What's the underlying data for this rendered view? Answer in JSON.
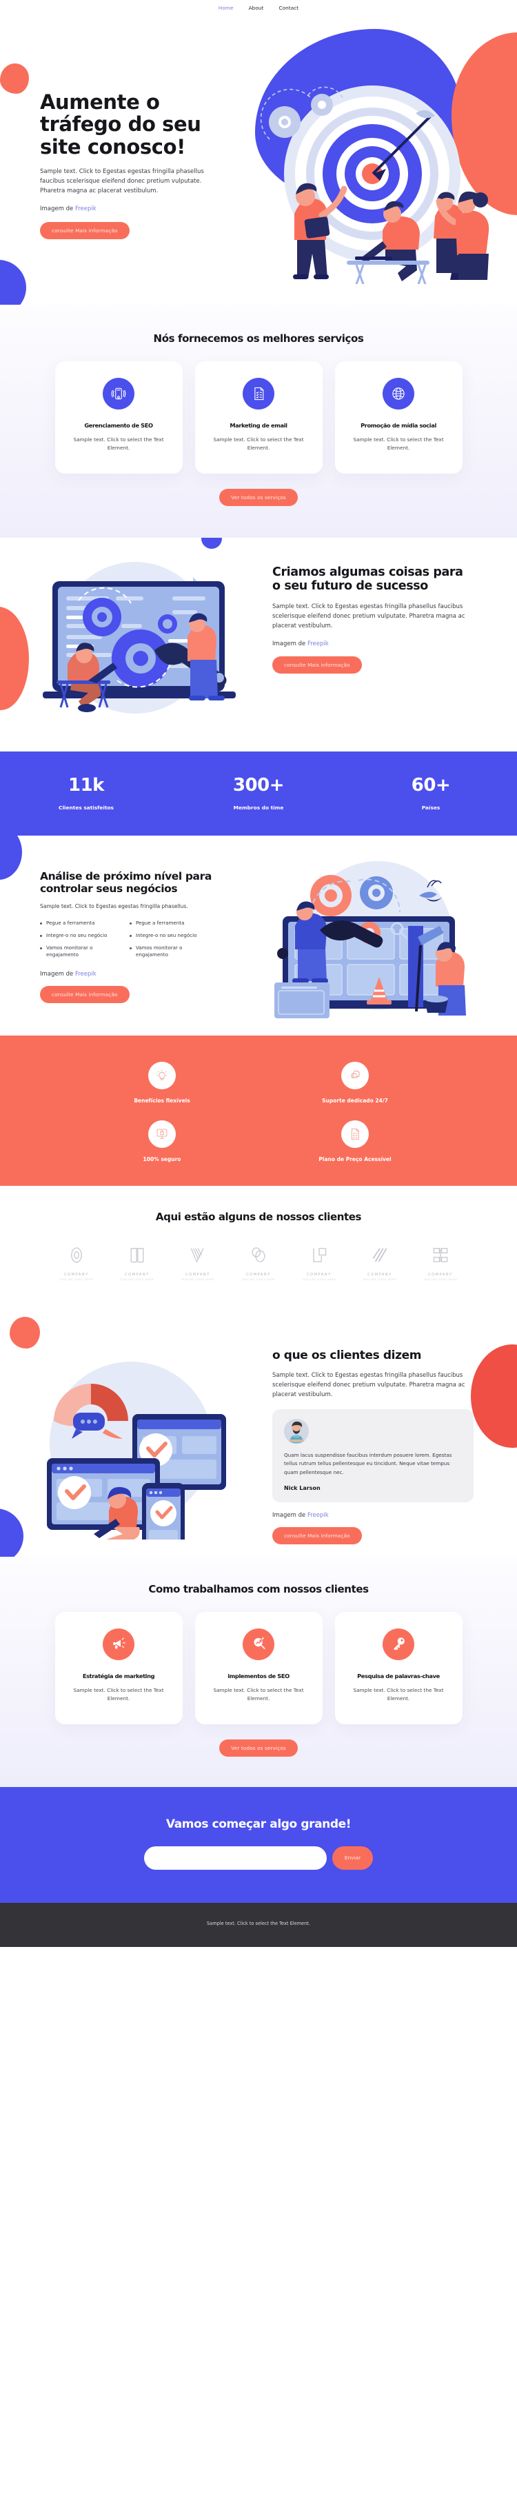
{
  "nav": {
    "items": [
      {
        "label": "Home",
        "active": true
      },
      {
        "label": "About",
        "active": false
      },
      {
        "label": "Contact",
        "active": false
      }
    ]
  },
  "hero": {
    "title": "Aumente o tráfego do seu site conosco!",
    "body": "Sample text. Click to Egestas egestas fringilla phasellus faucibus scelerisque eleifend donec pretium vulputate. Pharetra magna ac placerat vestibulum.",
    "credit_prefix": "Imagem de ",
    "credit_link": "Freepik",
    "cta": "consulte Mais informação",
    "illustration": "target-team-dartboard-illustration"
  },
  "services": {
    "title": "Nós fornecemos os melhores serviços",
    "cards": [
      {
        "icon": "mobile-signal-icon",
        "title": "Gerenciamento de SEO",
        "body": "Sample text. Click to select the Text Element."
      },
      {
        "icon": "checklist-document-icon",
        "title": "Marketing de email",
        "body": "Sample text. Click to select the Text Element."
      },
      {
        "icon": "globe-icon",
        "title": "Promoção de mídia social",
        "body": "Sample text. Click to select the Text Element."
      }
    ],
    "cta": "Ver todos os serviços"
  },
  "future": {
    "title": "Criamos algumas coisas para o seu futuro de sucesso",
    "body": "Sample text. Click to Egestas egestas fringilla phasellus faucibus scelerisque eleifend donec pretium vulputate. Pharetra magna ac placerat vestibulum.",
    "credit_prefix": "Imagem de ",
    "credit_link": "Freepik",
    "cta": "consulte Mais informação",
    "illustration": "laptop-gears-wrench-illustration"
  },
  "stats": {
    "items": [
      {
        "value": "11k",
        "label": "Clientes satisfeitos"
      },
      {
        "value": "300+",
        "label": "Membros do time"
      },
      {
        "value": "60+",
        "label": "Países"
      }
    ]
  },
  "analytics": {
    "title": "Análise de próximo nível para controlar seus negócios",
    "lead": "Sample text. Click to Egestas egestas fringilla phasellus.",
    "list_left": [
      "Pegue a ferramenta",
      "Integre-o no seu negócio",
      "Vamos monitorar o engajamento"
    ],
    "list_right": [
      "Pegue a ferramenta",
      "Integre-o no seu negócio",
      "Vamos monitorar o engajamento"
    ],
    "credit_prefix": "Imagem de ",
    "credit_link": "Freepik",
    "cta": "consulte Mais informação",
    "illustration": "website-maintenance-wrench-illustration"
  },
  "benefits": {
    "items": [
      {
        "icon": "lightbulb-icon",
        "label": "Benefícios flexíveis"
      },
      {
        "icon": "gear-icon",
        "label": "Suporte dedicado 24/7"
      },
      {
        "icon": "monitor-lock-icon",
        "label": "100% seguro"
      },
      {
        "icon": "price-list-icon",
        "label": "Plano de Preço Acessível"
      }
    ]
  },
  "clients": {
    "title": "Aqui estão alguns de nossos clientes",
    "logos": [
      {
        "mark": "ring-mark",
        "name": "COMPANY",
        "tagline": "TAGLINE GOES HERE"
      },
      {
        "mark": "book-mark",
        "name": "COMPANY",
        "tagline": "TAGLINE GOES HERE"
      },
      {
        "mark": "vlines-mark",
        "name": "COMPANY",
        "tagline": "TAGLINE GOES HERE"
      },
      {
        "mark": "circles-mark",
        "name": "COMPANY",
        "tagline": "TAGLINE GOES HERE"
      },
      {
        "mark": "squares-mark",
        "name": "COMPANY",
        "tagline": "TAGLINE GOES HERE"
      },
      {
        "mark": "slashes-mark",
        "name": "COMPANY",
        "tagline": "TAGLINE GOES HERE"
      },
      {
        "mark": "bracket-mark",
        "name": "COMPANY",
        "tagline": "TAGLINE GOES HERE"
      }
    ]
  },
  "testimonials": {
    "title": "o que os clientes dizem",
    "body": "Sample text. Click to Egestas egestas fringilla phasellus faucibus scelerisque eleifend donec pretium vulputate. Pharetra magna ac placerat vestibulum.",
    "quote": "Quam lacus suspendisse faucibus interdum posuere lorem. Egestas tellus rutrum tellus pellentesque eu tincidunt. Neque vitae tempus quam pellentesque nec.",
    "author": "Nick Larson",
    "credit_prefix": "Imagem de ",
    "credit_link": "Freepik",
    "cta": "consulte Mais informação",
    "illustration": "responsive-devices-checkmarks-illustration"
  },
  "process": {
    "title": "Como trabalhamos com nossos clientes",
    "cards": [
      {
        "icon": "megaphone-icon",
        "title": "Estratégia de marketing",
        "body": "Sample text. Click to select the Text Element."
      },
      {
        "icon": "growth-search-icon",
        "title": "implementos de SEO",
        "body": "Sample text. Click to select the Text Element."
      },
      {
        "icon": "key-icon",
        "title": "Pesquisa de palavras-chave",
        "body": "Sample text. Click to select the Text Element."
      }
    ],
    "cta": "Ver todos os serviços"
  },
  "cta": {
    "title": "Vamos começar algo grande!",
    "input_value": "",
    "input_placeholder": "",
    "button": "Enviar"
  },
  "footer": {
    "text": "Sample text. Click to select the Text Element."
  },
  "colors": {
    "blue": "#4b4fec",
    "coral": "#f96e5b",
    "dark": "#16161b",
    "lavender": "#7b7fe0",
    "footer_bg": "#333338"
  }
}
